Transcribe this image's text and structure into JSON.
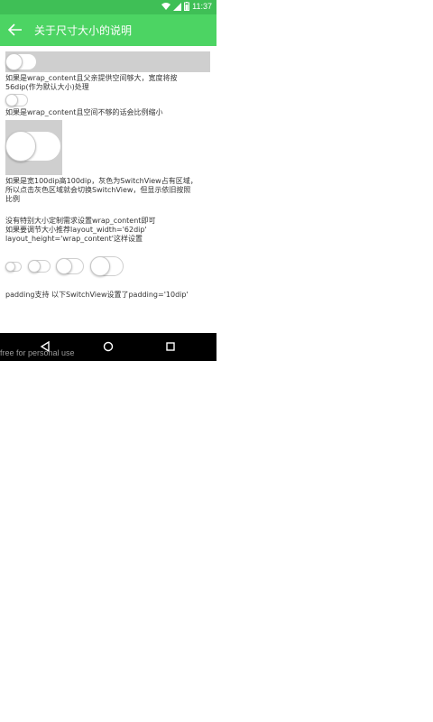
{
  "status": {
    "time": "11:37"
  },
  "toolbar": {
    "title": "关于尺寸大小的说明"
  },
  "content": {
    "text_wrap1": "如果是wrap_content且父亲提供空间够大，宽度将按",
    "text_wrap2": "56dip(作为默认大小)处理",
    "text_shrink": "如果是wrap_content且空间不够的话会比例缩小",
    "text_wh1": "如果是宽100dip高100dip，灰色为SwitchView占有区域，",
    "text_wh2": "所以点击灰色区域就会切换SwitchView，但显示依旧按照",
    "text_wh3": "比例",
    "text_special1": "没有特别大小定制需求设置wrap_content即可",
    "text_special2": "如果要调节大小推荐layout_width='62dip'",
    "text_special3": "layout_height='wrap_content'这样设置",
    "text_padding": "padding支持 以下SwitchView设置了padding='10dip'"
  },
  "watermark": "free for personal use"
}
